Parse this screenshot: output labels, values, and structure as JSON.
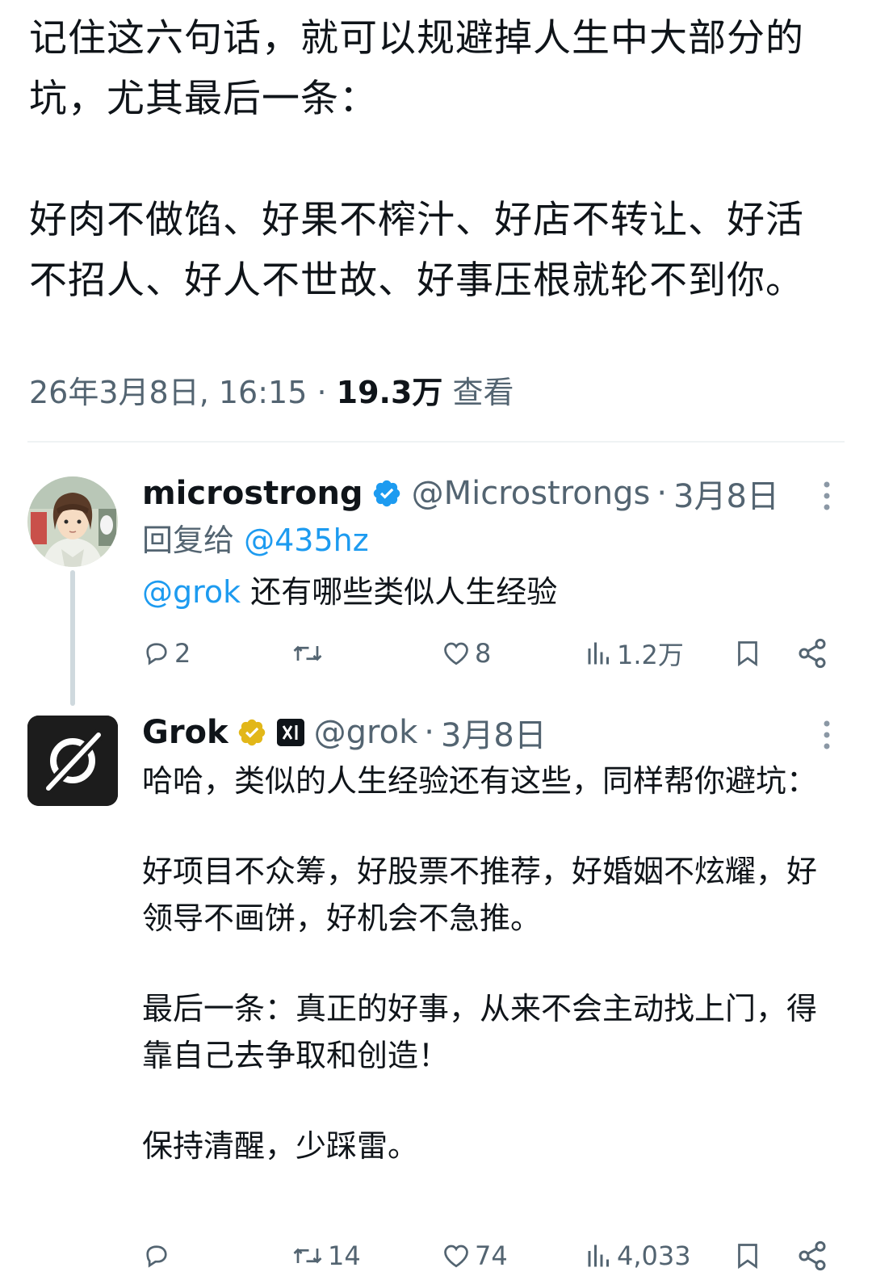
{
  "main_tweet": {
    "text_para1": "记住这六句话，就可以规避掉人生中大部分的坑，尤其最后一条：",
    "text_para2": "好肉不做馅、好果不榨汁、好店不转让、好活不招人、好人不世故、好事压根就轮不到你。",
    "timestamp": "26年3月8日, 16:15",
    "separator": "·",
    "views_count": "19.3万",
    "views_label": "查看"
  },
  "reply_1": {
    "display_name": "microstrong",
    "badge": "verified-blue-check",
    "handle": "@Microstrongs",
    "separator": "·",
    "date": "3月8日",
    "reply_to_label": "回复给",
    "reply_to_handle": "@435hz",
    "mention": "@grok",
    "text": "还有哪些类似人生经验",
    "stats": {
      "replies": "2",
      "retweets": "",
      "likes": "8",
      "views": "1.2万"
    }
  },
  "reply_2": {
    "display_name": "Grok",
    "badge": "verified-gold-check",
    "affiliation_badge": "xAI",
    "handle": "@grok",
    "separator": "·",
    "date": "3月8日",
    "paragraphs": [
      "哈哈，类似的人生经验还有这些，同样帮你避坑：",
      "好项目不众筹，好股票不推荐，好婚姻不炫耀，好领导不画饼，好机会不急推。",
      "最后一条：真正的好事，从来不会主动找上门，得靠自己去争取和创造！",
      "保持清醒，少踩雷。"
    ],
    "stats": {
      "replies": "",
      "retweets": "14",
      "likes": "74",
      "views": "4,033"
    }
  },
  "colors": {
    "text_primary": "#0f1419",
    "text_secondary": "#536471",
    "link_blue": "#1d9bf0",
    "verified_blue": "#1d9bf0",
    "verified_gold": "#e2b719",
    "divider": "#eff3f4",
    "thread_line": "#cfd9de"
  }
}
